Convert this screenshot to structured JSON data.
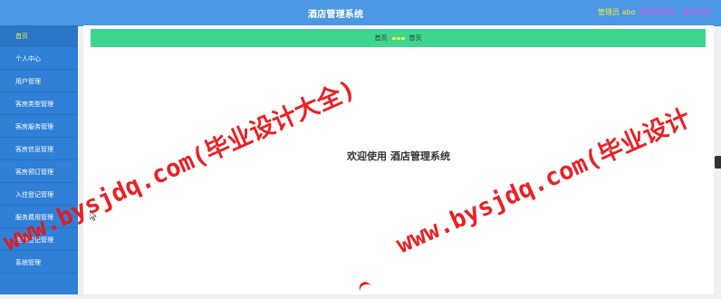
{
  "header": {
    "title": "酒店管理系统",
    "user": "管理员 abo",
    "links": [
      "退出到前台",
      "退出登录"
    ]
  },
  "sidebar": {
    "items": [
      {
        "label": "首页",
        "active": true
      },
      {
        "label": "个人中心",
        "active": false
      },
      {
        "label": "用户管理",
        "active": false
      },
      {
        "label": "客房类型管理",
        "active": false
      },
      {
        "label": "客房服务管理",
        "active": false
      },
      {
        "label": "客房信息管理",
        "active": false
      },
      {
        "label": "客房预订管理",
        "active": false
      },
      {
        "label": "入住登记管理",
        "active": false
      },
      {
        "label": "服务费用管理",
        "active": false
      },
      {
        "label": "退房登记管理",
        "active": false
      },
      {
        "label": "系统管理",
        "active": false
      }
    ]
  },
  "breadcrumb": {
    "root": "首页",
    "current": "首页"
  },
  "main": {
    "welcome_prefix": "欢迎使用",
    "welcome_system": "酒店管理系统"
  },
  "watermarks": [
    "www.bysjdq.com(毕业设计大全)",
    "www.bysjdq.com(毕业设计"
  ],
  "colors": {
    "header_bg": "#4b97e4",
    "sidebar_bg": "#2f80d6",
    "breadcrumb_bg": "#3ed68f",
    "accent_yellow": "#f6ec3a",
    "link_pink": "#e04df0",
    "watermark_red": "#e8161a"
  }
}
